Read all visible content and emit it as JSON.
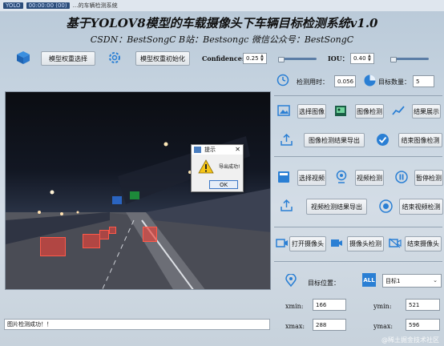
{
  "window": {
    "title_blur": "YOLO",
    "title_blur2": "00:00:00 (00)",
    "title": "…的车辆检测系统"
  },
  "header": {
    "title": "基于YOLOV8模型的车载摄像头下车辆目标检测系统v1.0",
    "subtitle": "CSDN：BestSongC   B站：Bestsongc   微信公众号：BestSongC"
  },
  "toolbar": {
    "select_weights": "模型权重选择",
    "init_weights": "模型权重初始化",
    "confidence_label": "Confidence:",
    "confidence_value": "0.25",
    "iou_label": "IOU：",
    "iou_value": "0.40",
    "confidence_level": 0.25,
    "iou_level": 0.4
  },
  "stats": {
    "time_label": "检测用时：",
    "time_value": "0.056",
    "count_label": "目标数量：",
    "count_value": "5"
  },
  "image_row": {
    "select": "选择图像",
    "detect": "图像检测",
    "show": "结果展示"
  },
  "export_image": {
    "export": "图像检测结果导出",
    "stop": "结束图像检测"
  },
  "video_row": {
    "select": "选择视频",
    "detect": "视频检测",
    "pause": "暂停检测"
  },
  "export_video": {
    "export": "视频检测结果导出",
    "stop": "结束视频检测"
  },
  "camera_row": {
    "open": "打开摄像头",
    "detect": "摄像头检测",
    "close": "结束摄像头"
  },
  "target": {
    "position_label": "目标位置：",
    "all_badge": "ALL",
    "select_value": "目标1",
    "xmin_label": "xmin:",
    "xmin": "166",
    "ymin_label": "ymin:",
    "ymin": "521",
    "xmax_label": "xmax:",
    "xmax": "288",
    "ymax_label": "ymax:",
    "ymax": "596"
  },
  "dialog": {
    "title": "提示",
    "message": "导出成功!",
    "ok": "OK"
  },
  "status": {
    "text": "图片检测成功！！"
  },
  "watermark": "@稀土掘金技术社区",
  "colors": {
    "accent": "#2a7fd4",
    "detect_box": "#e8433a",
    "panel_bg": "#c9d6e2"
  }
}
